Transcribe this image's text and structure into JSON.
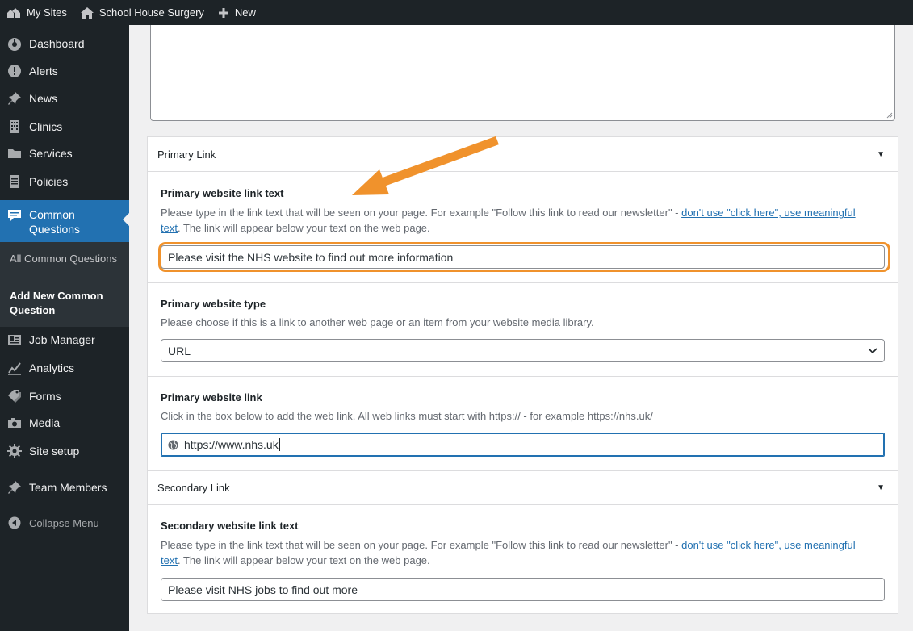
{
  "adminbar": {
    "my_sites": "My Sites",
    "site_name": "School House Surgery",
    "new_label": "New"
  },
  "sidebar": {
    "items": [
      {
        "label": "Dashboard",
        "icon": "dashboard-icon"
      },
      {
        "label": "Alerts",
        "icon": "alert-icon"
      },
      {
        "label": "News",
        "icon": "pin-icon"
      },
      {
        "label": "Clinics",
        "icon": "building-icon"
      },
      {
        "label": "Services",
        "icon": "folder-icon"
      },
      {
        "label": "Policies",
        "icon": "document-icon"
      },
      {
        "label": "Common Questions",
        "icon": "comment-icon"
      },
      {
        "label": "Job Manager",
        "icon": "id-card-icon"
      },
      {
        "label": "Analytics",
        "icon": "chart-line-icon"
      },
      {
        "label": "Forms",
        "icon": "tags-icon"
      },
      {
        "label": "Media",
        "icon": "camera-icon"
      },
      {
        "label": "Site setup",
        "icon": "gear-icon"
      },
      {
        "label": "Team Members",
        "icon": "pin-icon"
      }
    ],
    "submenu": [
      "All Common Questions",
      "Add New Common Question"
    ],
    "collapse": "Collapse Menu"
  },
  "primary": {
    "heading": "Primary Link",
    "link_text_label": "Primary website link text",
    "link_text_desc_1": "Please type in the link text that will be seen on your page. For example \"Follow this link to read our newsletter\" - ",
    "link_text_desc_link": "don't use \"click here\", use meaningful text",
    "link_text_desc_2": ". The link will appear below your text on the web page.",
    "link_text_value": "Please visit the NHS website to find out more information",
    "type_label": "Primary website type",
    "type_desc": "Please choose if this is a link to another web page or an item from your website media library.",
    "type_value": "URL",
    "link_label": "Primary website link",
    "link_desc": "Click in the box below to add the web link. All web links must start with https:// - for example https://nhs.uk/",
    "link_value": "https://www.nhs.uk"
  },
  "secondary": {
    "heading": "Secondary Link",
    "link_text_label": "Secondary website link text",
    "link_text_desc_1": "Please type in the link text that will be seen on your page. For example \"Follow this link to read our newsletter\" - ",
    "link_text_desc_link": "don't use \"click here\", use meaningful text",
    "link_text_desc_2": ". The link will appear below your text on the web page.",
    "link_text_value": "Please visit NHS jobs to find out more"
  },
  "colors": {
    "admin_bg": "#1d2327",
    "accent": "#2271b1",
    "highlight": "#f0922c"
  }
}
